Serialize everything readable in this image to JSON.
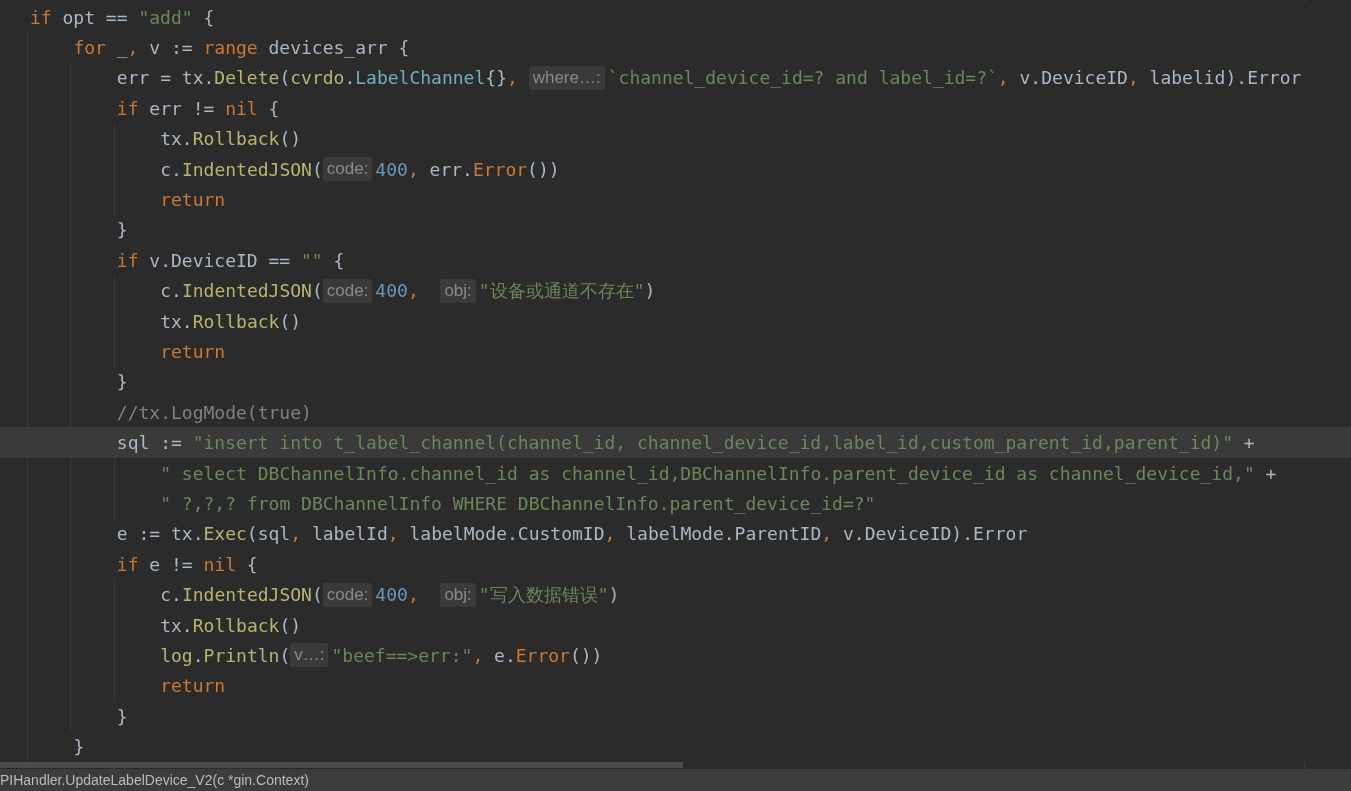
{
  "editor": {
    "lines": [
      {
        "current": false,
        "tokens": [
          {
            "kind": "keyword",
            "text": "if "
          },
          {
            "kind": "plain",
            "text": "opt == "
          },
          {
            "kind": "string",
            "text": "\"add\""
          },
          {
            "kind": "plain",
            "text": " {"
          }
        ],
        "children": [
          {
            "current": false,
            "tokens": [
              {
                "kind": "keyword",
                "text": "for "
              },
              {
                "kind": "plain",
                "text": "_"
              },
              {
                "kind": "punct",
                "text": ", "
              },
              {
                "kind": "plain",
                "text": "v := "
              },
              {
                "kind": "keyword",
                "text": "range "
              },
              {
                "kind": "plain",
                "text": "devices_arr {"
              }
            ],
            "children": [
              {
                "current": false,
                "tokens": [
                  {
                    "kind": "plain",
                    "text": "err = tx."
                  },
                  {
                    "kind": "call",
                    "text": "Delete"
                  },
                  {
                    "kind": "plain",
                    "text": "("
                  },
                  {
                    "kind": "package",
                    "text": "cvrdo"
                  },
                  {
                    "kind": "plain",
                    "text": "."
                  },
                  {
                    "kind": "type",
                    "text": "LabelChannel"
                  },
                  {
                    "kind": "plain",
                    "text": "{}"
                  },
                  {
                    "kind": "punct",
                    "text": ", "
                  },
                  {
                    "kind": "hint",
                    "text": "where…:"
                  },
                  {
                    "kind": "string",
                    "text": "`channel_device_id=? and label_id=?`"
                  },
                  {
                    "kind": "punct",
                    "text": ", "
                  },
                  {
                    "kind": "plain",
                    "text": "v.DeviceID"
                  },
                  {
                    "kind": "punct",
                    "text": ", "
                  },
                  {
                    "kind": "plain",
                    "text": "labelid).Error"
                  }
                ]
              },
              {
                "current": false,
                "tokens": [
                  {
                    "kind": "keyword",
                    "text": "if "
                  },
                  {
                    "kind": "plain",
                    "text": "err != "
                  },
                  {
                    "kind": "keyword",
                    "text": "nil "
                  },
                  {
                    "kind": "plain",
                    "text": "{"
                  }
                ],
                "children": [
                  {
                    "current": false,
                    "tokens": [
                      {
                        "kind": "plain",
                        "text": "tx."
                      },
                      {
                        "kind": "call",
                        "text": "Rollback"
                      },
                      {
                        "kind": "plain",
                        "text": "()"
                      }
                    ]
                  },
                  {
                    "current": false,
                    "tokens": [
                      {
                        "kind": "plain",
                        "text": "c."
                      },
                      {
                        "kind": "call",
                        "text": "IndentedJSON"
                      },
                      {
                        "kind": "plain",
                        "text": "("
                      },
                      {
                        "kind": "hint",
                        "text": "code:"
                      },
                      {
                        "kind": "number",
                        "text": "400"
                      },
                      {
                        "kind": "punct",
                        "text": ", "
                      },
                      {
                        "kind": "plain",
                        "text": "err."
                      },
                      {
                        "kind": "builtin",
                        "text": "Error"
                      },
                      {
                        "kind": "plain",
                        "text": "())"
                      }
                    ]
                  },
                  {
                    "current": false,
                    "tokens": [
                      {
                        "kind": "keyword",
                        "text": "return"
                      }
                    ]
                  }
                ]
              },
              {
                "current": false,
                "tokens": [
                  {
                    "kind": "plain",
                    "text": "}"
                  }
                ]
              },
              {
                "current": false,
                "tokens": [
                  {
                    "kind": "keyword",
                    "text": "if "
                  },
                  {
                    "kind": "plain",
                    "text": "v.DeviceID == "
                  },
                  {
                    "kind": "string",
                    "text": "\"\""
                  },
                  {
                    "kind": "plain",
                    "text": " {"
                  }
                ],
                "children": [
                  {
                    "current": false,
                    "tokens": [
                      {
                        "kind": "plain",
                        "text": "c."
                      },
                      {
                        "kind": "call",
                        "text": "IndentedJSON"
                      },
                      {
                        "kind": "plain",
                        "text": "("
                      },
                      {
                        "kind": "hint",
                        "text": "code:"
                      },
                      {
                        "kind": "number",
                        "text": "400"
                      },
                      {
                        "kind": "punct",
                        "text": ",  "
                      },
                      {
                        "kind": "hint",
                        "text": "obj:"
                      },
                      {
                        "kind": "string",
                        "text": "\"设备或通道不存在\""
                      },
                      {
                        "kind": "plain",
                        "text": ")"
                      }
                    ]
                  },
                  {
                    "current": false,
                    "tokens": [
                      {
                        "kind": "plain",
                        "text": "tx."
                      },
                      {
                        "kind": "call",
                        "text": "Rollback"
                      },
                      {
                        "kind": "plain",
                        "text": "()"
                      }
                    ]
                  },
                  {
                    "current": false,
                    "tokens": [
                      {
                        "kind": "keyword",
                        "text": "return"
                      }
                    ]
                  }
                ]
              },
              {
                "current": false,
                "tokens": [
                  {
                    "kind": "plain",
                    "text": "}"
                  }
                ]
              },
              {
                "current": false,
                "tokens": [
                  {
                    "kind": "comment",
                    "text": "//tx.LogMode(true)"
                  }
                ]
              },
              {
                "current": true,
                "tokens": [
                  {
                    "kind": "plain",
                    "text": "sql := "
                  },
                  {
                    "kind": "string",
                    "text": "\"insert into t_label_channel(channel_id, channel_device_id,label_id,custom_parent_id,parent_id)\""
                  },
                  {
                    "kind": "plain",
                    "text": " +"
                  }
                ],
                "children": [
                  {
                    "current": false,
                    "tokens": [
                      {
                        "kind": "string",
                        "text": "\" select DBChannelInfo.channel_id as channel_id,DBChannelInfo.parent_device_id as channel_device_id,\""
                      },
                      {
                        "kind": "plain",
                        "text": " +"
                      }
                    ]
                  },
                  {
                    "current": false,
                    "tokens": [
                      {
                        "kind": "string",
                        "text": "\" ?,?,? from DBChannelInfo WHERE DBChannelInfo.parent_device_id=?\""
                      }
                    ]
                  }
                ]
              },
              {
                "current": false,
                "tokens": [
                  {
                    "kind": "plain",
                    "text": "e := tx."
                  },
                  {
                    "kind": "call",
                    "text": "Exec"
                  },
                  {
                    "kind": "plain",
                    "text": "(sql"
                  },
                  {
                    "kind": "punct",
                    "text": ", "
                  },
                  {
                    "kind": "plain",
                    "text": "labelId"
                  },
                  {
                    "kind": "punct",
                    "text": ", "
                  },
                  {
                    "kind": "plain",
                    "text": "labelMode.CustomID"
                  },
                  {
                    "kind": "punct",
                    "text": ", "
                  },
                  {
                    "kind": "plain",
                    "text": "labelMode.ParentID"
                  },
                  {
                    "kind": "punct",
                    "text": ", "
                  },
                  {
                    "kind": "plain",
                    "text": "v.DeviceID).Error"
                  }
                ]
              },
              {
                "current": false,
                "tokens": [
                  {
                    "kind": "keyword",
                    "text": "if "
                  },
                  {
                    "kind": "plain",
                    "text": "e != "
                  },
                  {
                    "kind": "keyword",
                    "text": "nil "
                  },
                  {
                    "kind": "plain",
                    "text": "{"
                  }
                ],
                "children": [
                  {
                    "current": false,
                    "tokens": [
                      {
                        "kind": "plain",
                        "text": "c."
                      },
                      {
                        "kind": "call",
                        "text": "IndentedJSON"
                      },
                      {
                        "kind": "plain",
                        "text": "("
                      },
                      {
                        "kind": "hint",
                        "text": "code:"
                      },
                      {
                        "kind": "number",
                        "text": "400"
                      },
                      {
                        "kind": "punct",
                        "text": ",  "
                      },
                      {
                        "kind": "hint",
                        "text": "obj:"
                      },
                      {
                        "kind": "string",
                        "text": "\"写入数据错误\""
                      },
                      {
                        "kind": "plain",
                        "text": ")"
                      }
                    ]
                  },
                  {
                    "current": false,
                    "tokens": [
                      {
                        "kind": "plain",
                        "text": "tx."
                      },
                      {
                        "kind": "call",
                        "text": "Rollback"
                      },
                      {
                        "kind": "plain",
                        "text": "()"
                      }
                    ]
                  },
                  {
                    "current": false,
                    "tokens": [
                      {
                        "kind": "package",
                        "text": "log"
                      },
                      {
                        "kind": "plain",
                        "text": "."
                      },
                      {
                        "kind": "call",
                        "text": "Println"
                      },
                      {
                        "kind": "plain",
                        "text": "("
                      },
                      {
                        "kind": "hint",
                        "text": "v…:"
                      },
                      {
                        "kind": "string",
                        "text": "\"beef==>err:\""
                      },
                      {
                        "kind": "punct",
                        "text": ", "
                      },
                      {
                        "kind": "plain",
                        "text": "e."
                      },
                      {
                        "kind": "builtin",
                        "text": "Error"
                      },
                      {
                        "kind": "plain",
                        "text": "())"
                      }
                    ]
                  },
                  {
                    "current": false,
                    "tokens": [
                      {
                        "kind": "keyword",
                        "text": "return"
                      }
                    ]
                  }
                ]
              },
              {
                "current": false,
                "tokens": [
                  {
                    "kind": "plain",
                    "text": "}"
                  }
                ]
              }
            ]
          },
          {
            "current": false,
            "tokens": [
              {
                "kind": "plain",
                "text": "}"
              }
            ]
          }
        ]
      }
    ]
  },
  "status_bar": {
    "breadcrumb": "PIHandler.UpdateLabelDevice_V2(c *gin.Context)"
  }
}
